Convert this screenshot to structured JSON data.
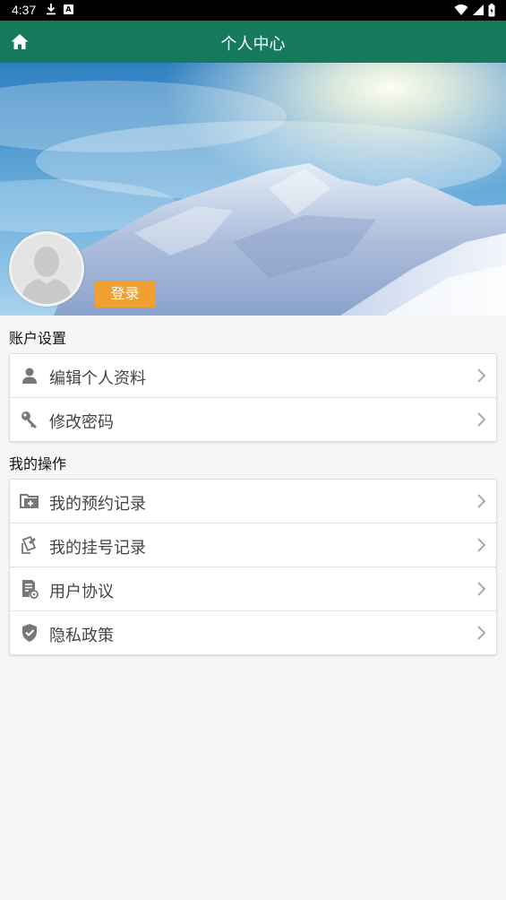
{
  "status_bar": {
    "time": "4:37"
  },
  "app_bar": {
    "title": "个人中心"
  },
  "profile": {
    "login_label": "登录"
  },
  "account_settings": {
    "title": "账户设置",
    "items": [
      {
        "label": "编辑个人资料",
        "icon": "person-icon"
      },
      {
        "label": "修改密码",
        "icon": "key-icon"
      }
    ]
  },
  "my_operations": {
    "title": "我的操作",
    "items": [
      {
        "label": "我的预约记录",
        "icon": "folder-add-icon"
      },
      {
        "label": "我的挂号记录",
        "icon": "document-pen-icon"
      }
    ]
  },
  "other": {
    "items": [
      {
        "label": "用户协议",
        "icon": "agreement-icon"
      },
      {
        "label": "隐私政策",
        "icon": "shield-check-icon"
      }
    ]
  },
  "colors": {
    "app_bar": "#157a5c",
    "login_button": "#f0a030",
    "background": "#f4f7f6"
  }
}
